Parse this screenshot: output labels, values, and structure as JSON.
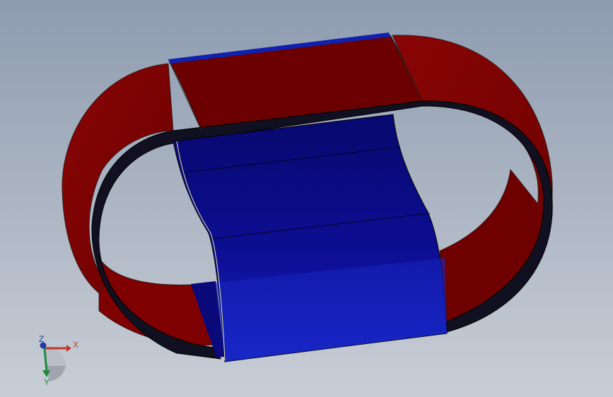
{
  "viewport": {
    "background_top": "#8e9cb0",
    "background_bottom": "#c9ced6"
  },
  "model": {
    "belt_color": "#7a0000",
    "belt_color_light": "#9a0a0a",
    "plate_color": "#0a0a8c",
    "plate_color_light": "#1a24c8",
    "edge_color": "#111111"
  },
  "triad": {
    "x_label": "X",
    "y_label": "Y",
    "z_label": "Z",
    "x_color": "#c0392b",
    "y_color": "#1e8a3c",
    "z_color": "#1f3aa8"
  }
}
